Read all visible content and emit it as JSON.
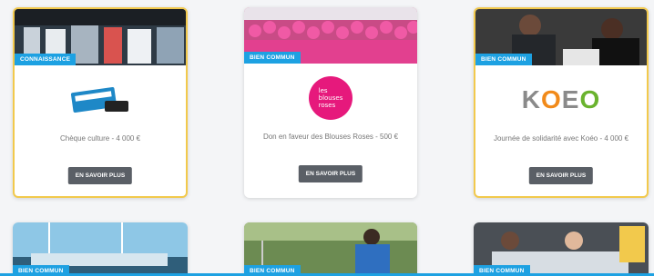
{
  "cards": [
    {
      "badge": "CONNAISSANCE",
      "title": "Chèque culture - 4 000 €",
      "button": "EN SAVOIR PLUS"
    },
    {
      "badge": "BIEN COMMUN",
      "title": "Don en faveur des Blouses Roses - 500 €",
      "button": "EN SAVOIR PLUS",
      "logo_text": [
        "les",
        "blouses",
        "roses"
      ]
    },
    {
      "badge": "BIEN COMMUN",
      "title": "Journée de solidarité avec Koéo - 4 000 €",
      "button": "EN SAVOIR PLUS",
      "logo_text": "KOEO"
    },
    {
      "badge": "BIEN COMMUN"
    },
    {
      "badge": "BIEN COMMUN"
    },
    {
      "badge": "BIEN COMMUN"
    }
  ],
  "colors": {
    "badge": "#1da1e2",
    "button": "#5a5f66",
    "highlight": "#f2c94c",
    "rose": "#e6197c"
  }
}
